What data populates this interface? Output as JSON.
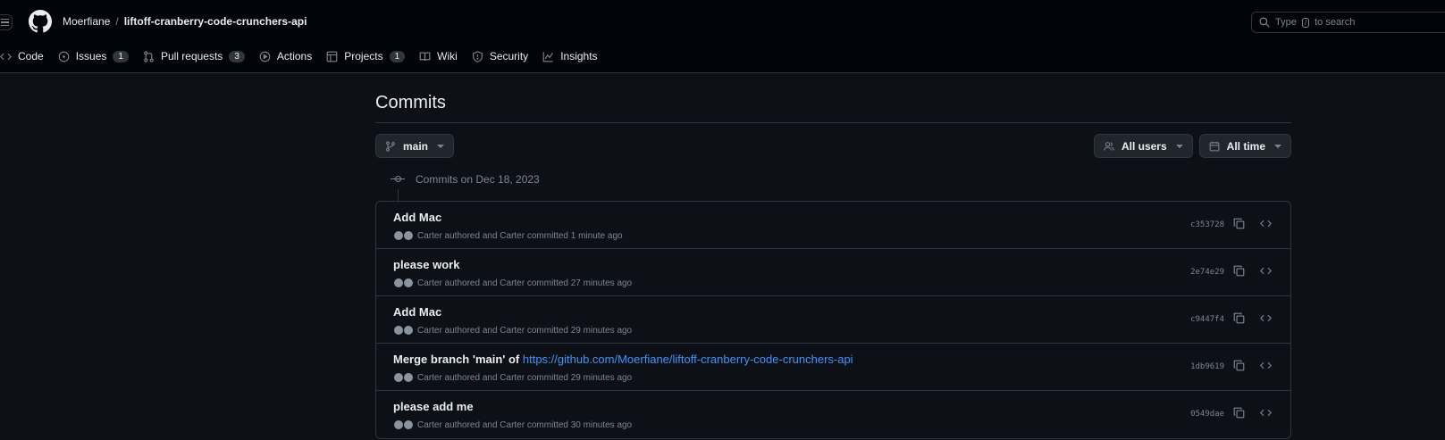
{
  "header": {
    "owner": "Moerfiane",
    "separator": "/",
    "repo": "liftoff-cranberry-code-crunchers-api",
    "search_prefix": "Type",
    "search_key": "/",
    "search_suffix": "to search"
  },
  "tabs": [
    {
      "label": "Code",
      "icon": "code-icon"
    },
    {
      "label": "Issues",
      "icon": "issue-icon",
      "count": "1"
    },
    {
      "label": "Pull requests",
      "icon": "pull-request-icon",
      "count": "3"
    },
    {
      "label": "Actions",
      "icon": "play-icon"
    },
    {
      "label": "Projects",
      "icon": "table-icon",
      "count": "1"
    },
    {
      "label": "Wiki",
      "icon": "book-icon"
    },
    {
      "label": "Security",
      "icon": "shield-icon"
    },
    {
      "label": "Insights",
      "icon": "graph-icon"
    }
  ],
  "page": {
    "title": "Commits",
    "branch": "main",
    "users_filter": "All users",
    "time_filter": "All time",
    "group_label": "Commits on Dec 18, 2023"
  },
  "commits": [
    {
      "message": "Add Mac",
      "link": "",
      "meta": "Carter authored and Carter committed 1 minute ago",
      "sha": "c353728"
    },
    {
      "message": "please work",
      "link": "",
      "meta": "Carter authored and Carter committed 27 minutes ago",
      "sha": "2e74e29"
    },
    {
      "message": "Add Mac",
      "link": "",
      "meta": "Carter authored and Carter committed 29 minutes ago",
      "sha": "c9447f4"
    },
    {
      "message": "Merge branch 'main' of ",
      "link": "https://github.com/Moerfiane/liftoff-cranberry-code-crunchers-api",
      "meta": "Carter authored and Carter committed 29 minutes ago",
      "sha": "1db9619"
    },
    {
      "message": "please add me",
      "link": "",
      "meta": "Carter authored and Carter committed 30 minutes ago",
      "sha": "0549dae"
    }
  ],
  "colors": {
    "background": "#0d1117",
    "header": "#010409",
    "border": "#30363d",
    "muted": "#7d8590",
    "link": "#4493f8"
  }
}
